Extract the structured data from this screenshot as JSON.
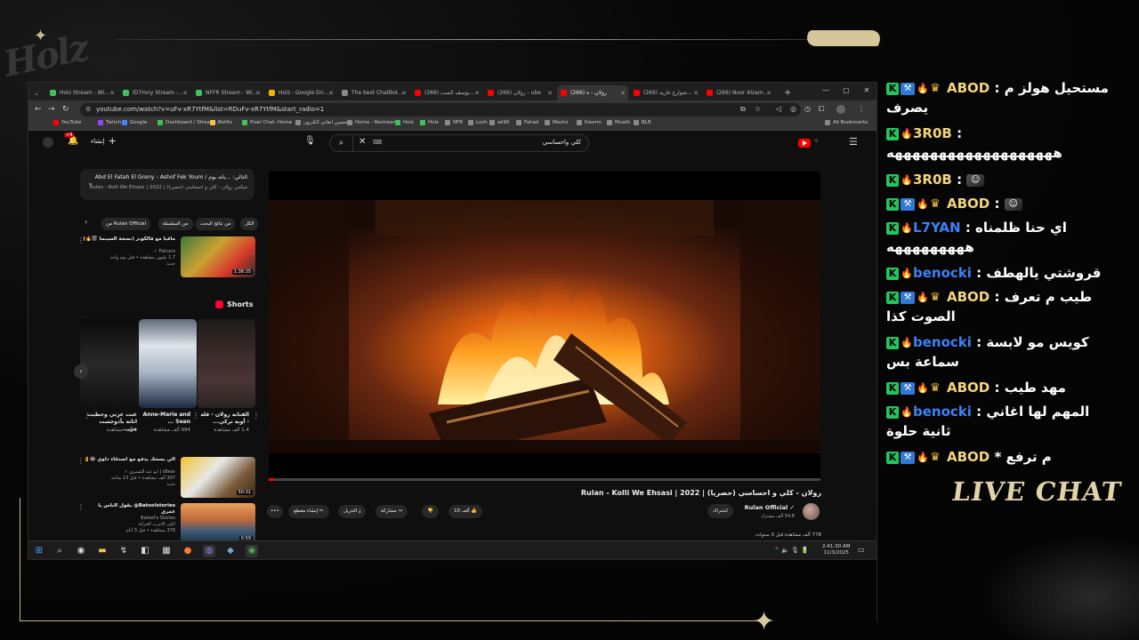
{
  "overlay": {
    "logo": "Holz",
    "live_chat_label": "LIVE CHAT"
  },
  "browser": {
    "tabs": [
      {
        "label": "Holz Stream - Wi...",
        "color": "#3ec35a"
      },
      {
        "label": "lD7mny Stream -...",
        "color": "#3ec35a"
      },
      {
        "label": "NFFR Stream - Wi...",
        "color": "#3ec35a"
      },
      {
        "label": "Holz - Google Dri...",
        "color": "#f4b400"
      },
      {
        "label": "The best ChatBot...",
        "color": "#8a8a8a"
      },
      {
        "label": "(266) يوسف الصب...",
        "color": "#ff0000"
      },
      {
        "label": "(266) روﻻن - ube",
        "color": "#ff0000"
      },
      {
        "label": "(266) روﻻن - ه",
        "color": "#ff0000"
      },
      {
        "label": "(266) شوارع غازيه...",
        "color": "#ff0000"
      },
      {
        "label": "(266) Noor Alzam...",
        "color": "#ff0000"
      }
    ],
    "url": "youtube.com/watch?v=uFv-xR7YtfM&list=RDuFv-xR7YtfM&start_radio=1",
    "bookmarks": [
      {
        "label": "YouTube",
        "color": "#ff0000"
      },
      {
        "label": "Twitch",
        "color": "#9146ff"
      },
      {
        "label": "Google",
        "color": "#4285f4"
      },
      {
        "label": "Dashboard / Stream...",
        "color": "#3ec35a"
      },
      {
        "label": "Botfix",
        "color": "#f5c542"
      },
      {
        "label": "Pixel Chat: Home",
        "color": "#3ec35a"
      },
      {
        "label": "تحسين انقاتي الكترون...",
        "color": "#8a8a8a"
      },
      {
        "label": "Home - Restream",
        "color": "#8a8a8a"
      },
      {
        "label": "Holz",
        "color": "#3ec35a"
      },
      {
        "label": "Holz",
        "color": "#3ec35a"
      },
      {
        "label": "NFR",
        "color": "#8a8a8a"
      },
      {
        "label": "Lozh",
        "color": "#8a8a8a"
      },
      {
        "label": "ak90",
        "color": "#8a8a8a"
      },
      {
        "label": "Fahad",
        "color": "#8a8a8a"
      },
      {
        "label": "Meshz",
        "color": "#8a8a8a"
      },
      {
        "label": "Kwerm",
        "color": "#8a8a8a"
      },
      {
        "label": "Muath",
        "color": "#8a8a8a"
      },
      {
        "label": "BLB",
        "color": "#8a8a8a"
      }
    ],
    "all_bookmarks": "All Bookmarks"
  },
  "youtube": {
    "search_value": "كلي واحساسي",
    "create_label": "إنشاء",
    "notif_count": "+9",
    "playlist": {
      "title": "التالي: ...ياته يوم / Abd El Fatah El Greny - Ashof Fek Youm",
      "subtitle": "ميكس روﻻن - كلي و احساسي (حصريا) | Rulan - Kolli We Ehsasi | 2022"
    },
    "chips": [
      "الكل",
      "من نتائج البحث",
      "من السلسلة",
      "من Rulan Official"
    ],
    "recs": [
      {
        "title": "ماقيا مع فالكونز (نسخة السينما 🎬🔥)",
        "channel": "Falcons ✓",
        "meta": "1.7 مليون مشاهدة • قبل يوم واحد",
        "meta2": "جديد",
        "dur": "1:38:35"
      },
      {
        "title": "الي يسحك يدفع مع اصدقاء داوي 😂👌",
        "channel": "sBear | ابو عبد الشمري ✓",
        "meta": "307 ألف مشاهدة • قبل 13 ساعة",
        "meta2": "جديد",
        "dur": "50:31"
      },
      {
        "title": "Batoolstories@ يقول الناس يا عمري",
        "channel": "Batool's Stories",
        "meta": "اغلى الاغرب الجرائد",
        "meta2": "376 مشاهدة • قبل 3 أيام",
        "dur": "0:59"
      }
    ],
    "shorts_label": "Shorts",
    "shorts": [
      {
        "title": "غنت عزتي وحطيت اثاثة بأذوجست من...",
        "views": "1 ألف مشاهدة"
      },
      {
        "title": "Anne-Marie and Sean ...",
        "views": "994 ألف مشاهدة"
      },
      {
        "title": "الفنانة روﻻن - فلة - أوبة تركي...",
        "views": "1.4 ألف مشاهدة"
      }
    ],
    "video_title": "روﻻن - كلي و احساسي (حصريا) | Rulan - Kolli We Ehsasi | 2022",
    "channel_name": "Rulan Official ✓",
    "channel_subs": "54.8 ألف مشترك",
    "subscribe": "اشتراك",
    "actions": {
      "like": "10 ألف",
      "share": "مشاركة",
      "download": "التنزيل",
      "clip": "إنشاء مقطع",
      "more": "•••"
    },
    "views_line": "778 ألف مشاهدة قبل 3 سنوات",
    "progress": 0.01
  },
  "taskbar": {
    "time": "2:41:30 AM",
    "date": "11/3/2025"
  },
  "chat": [
    {
      "badges": [
        "k",
        "wrench",
        "fire",
        "crown"
      ],
      "user": "ABOD",
      "color": "#f3d47a",
      "text": "مستحيل هولز م :",
      "text2": "يصرف"
    },
    {
      "badges": [
        "k",
        "fire"
      ],
      "user": "3R0B",
      "color": "#f3d47a",
      "text": ":",
      "text2": "هههههههههههههههههههه"
    },
    {
      "badges": [
        "k",
        "fire"
      ],
      "user": "3R0B",
      "color": "#f3d47a",
      "text": ":",
      "emote": "emote",
      "text2": ""
    },
    {
      "badges": [
        "k",
        "wrench",
        "fire",
        "crown"
      ],
      "user": "ABOD",
      "color": "#f3d47a",
      "text": ":",
      "emote": "emote",
      "text2": ""
    },
    {
      "badges": [
        "k",
        "fire"
      ],
      "user": "L7YAN",
      "color": "#3b82f6",
      "text": "اي حنا ظلمناه :",
      "text2": "هههههههههه"
    },
    {
      "badges": [
        "k",
        "fire"
      ],
      "user": "benocki",
      "color": "#3b82f6",
      "text": "قروشتي يالهطف :",
      "text2": ""
    },
    {
      "badges": [
        "k",
        "wrench",
        "fire",
        "crown"
      ],
      "user": "ABOD",
      "color": "#f3d47a",
      "text": "طيب م تعرف :",
      "text2": "الصوت كذا"
    },
    {
      "badges": [
        "k",
        "fire"
      ],
      "user": "benocki",
      "color": "#3b82f6",
      "text": "كويس مو لابسة :",
      "text2": "سماعة بس"
    },
    {
      "badges": [
        "k",
        "wrench",
        "fire",
        "crown"
      ],
      "user": "ABOD",
      "color": "#f3d47a",
      "text": "مهد طيب :",
      "text2": ""
    },
    {
      "badges": [
        "k",
        "fire"
      ],
      "user": "benocki",
      "color": "#3b82f6",
      "text": "المهم لها اغاني :",
      "text2": "ثانية حلوة"
    },
    {
      "badges": [
        "k",
        "wrench",
        "fire",
        "crown"
      ],
      "user": "ABOD",
      "color": "#f3d47a",
      "text": "م ترفع *",
      "text2": ""
    }
  ]
}
